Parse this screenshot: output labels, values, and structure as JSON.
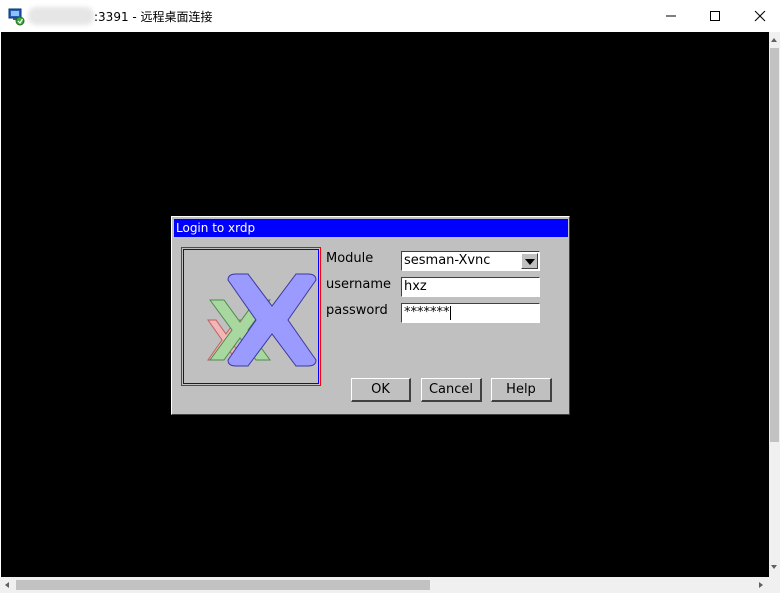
{
  "window": {
    "title": ":3391 - 远程桌面连接",
    "controls": {
      "minimize": "minimize",
      "maximize": "maximize",
      "close": "close"
    }
  },
  "dialog": {
    "title": "Login to xrdp",
    "module_label": "Module",
    "module_value": "sesman-Xvnc",
    "username_label": "username",
    "username_value": "hxz",
    "password_label": "password",
    "password_value": "*******",
    "ok_label": "OK",
    "cancel_label": "Cancel",
    "help_label": "Help"
  },
  "colors": {
    "remote_bg": "#000000",
    "dialog_bg": "#c0c0c0",
    "dialog_title_bg": "#0000ff",
    "logo_blue": "#9a9aff",
    "logo_green": "#a8d8a0",
    "logo_red": "#f0b0b0"
  },
  "icons": {
    "app": "remote-desktop-icon",
    "dropdown": "chevron-down-icon"
  }
}
